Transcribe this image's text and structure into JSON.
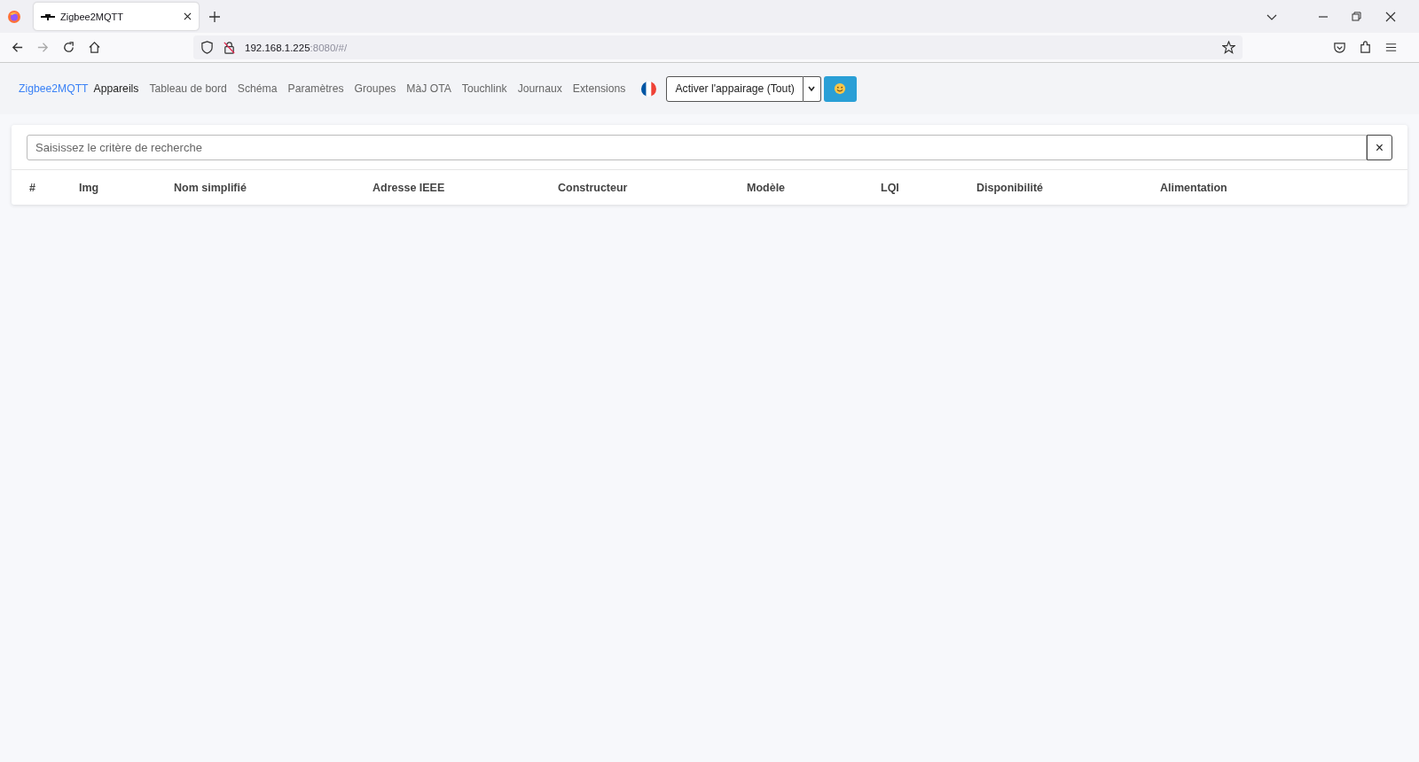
{
  "browser": {
    "tab_title": "Zigbee2MQTT",
    "url_host": "192.168.1.225",
    "url_rest": ":8080/#/"
  },
  "navbar": {
    "brand": "Zigbee2MQTT",
    "items": [
      {
        "label": "Appareils",
        "selected": true
      },
      {
        "label": "Tableau de bord",
        "selected": false
      },
      {
        "label": "Schéma",
        "selected": false
      },
      {
        "label": "Paramètres",
        "selected": false
      },
      {
        "label": "Groupes",
        "selected": false
      },
      {
        "label": "MàJ OTA",
        "selected": false
      },
      {
        "label": "Touchlink",
        "selected": false
      },
      {
        "label": "Journaux",
        "selected": false
      },
      {
        "label": "Extensions",
        "selected": false
      }
    ],
    "permit_join_button": "Activer l'appairage (Tout)"
  },
  "search": {
    "placeholder": "Saisissez le critère de recherche",
    "clear_button": "×"
  },
  "table": {
    "columns": [
      "#",
      "Img",
      "Nom simplifié",
      "Adresse IEEE",
      "Constructeur",
      "Modèle",
      "LQI",
      "Disponibilité",
      "Alimentation"
    ]
  }
}
